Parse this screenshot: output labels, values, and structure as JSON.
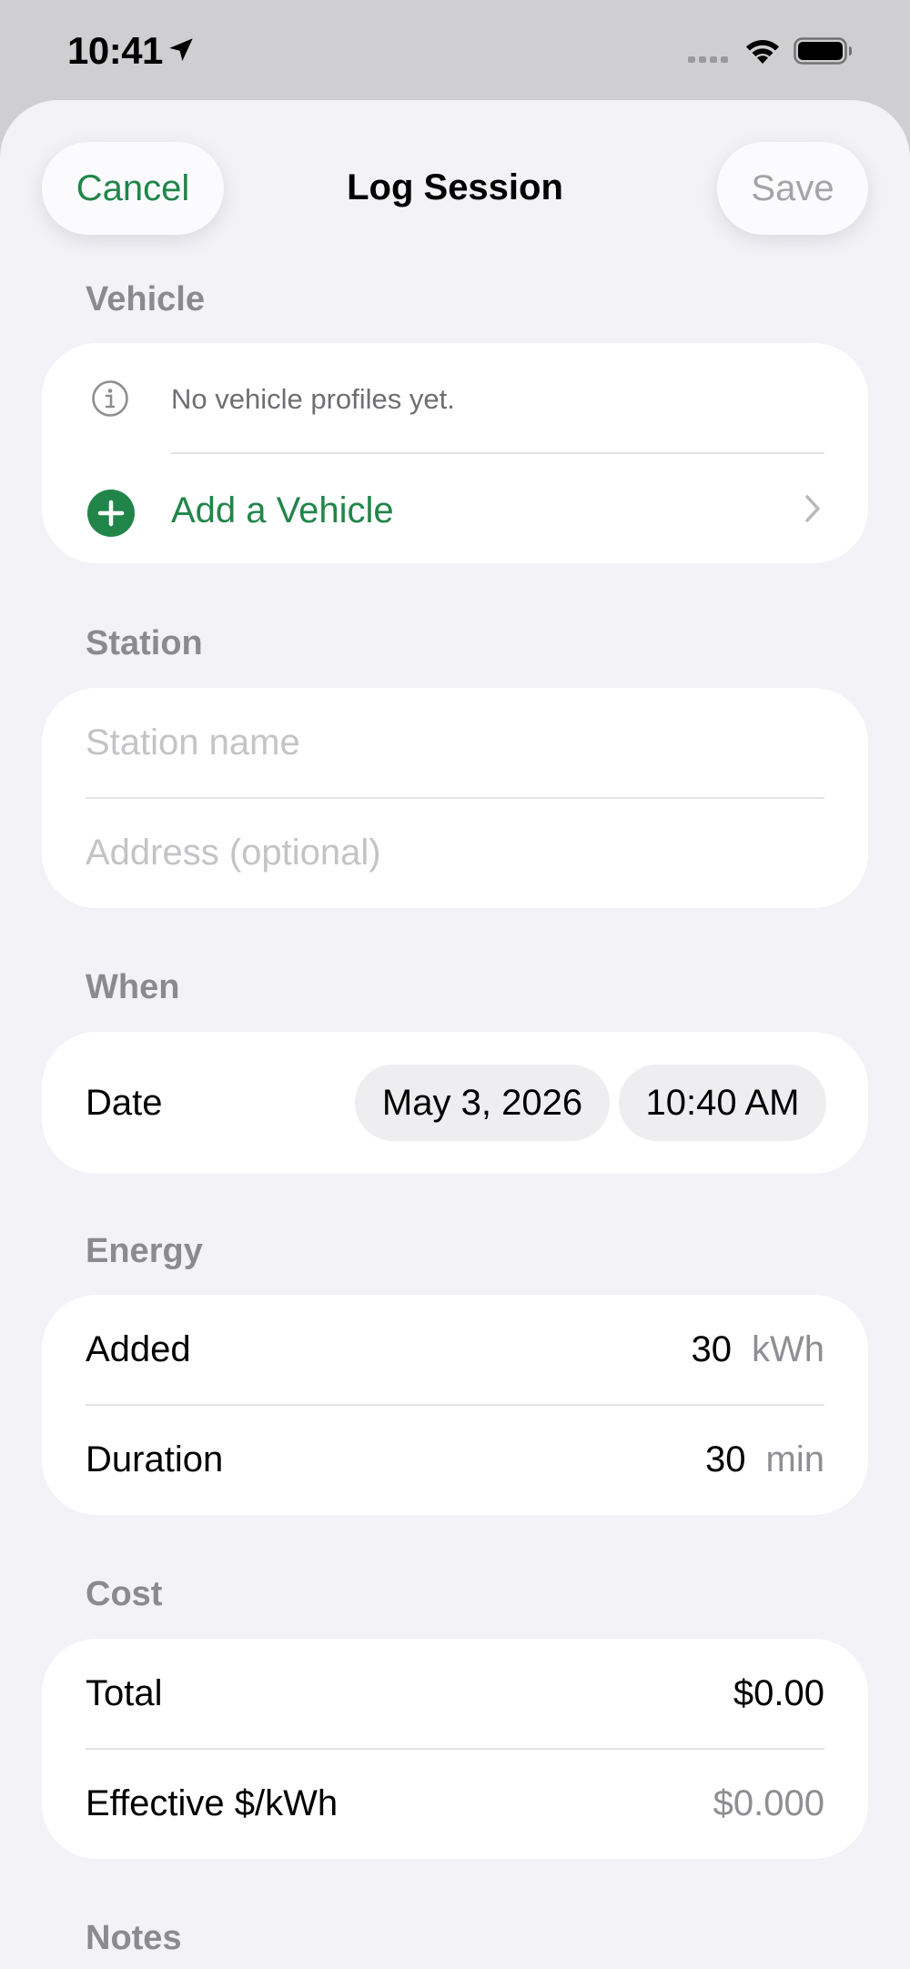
{
  "status_bar": {
    "time": "10:41",
    "icons": [
      "location-arrow-icon",
      "signal-icon",
      "wifi-icon",
      "battery-icon"
    ]
  },
  "nav": {
    "cancel_label": "Cancel",
    "title": "Log Session",
    "save_label": "Save"
  },
  "colors": {
    "accent": "#21854a",
    "background": "#f2f2f7",
    "card": "#ffffff",
    "secondary_text": "#8a8a8f",
    "placeholder": "#c4c4c7"
  },
  "sections": {
    "vehicle": {
      "header": "Vehicle",
      "info_text": "No vehicle profiles yet.",
      "info_icon": "info-icon",
      "add_label": "Add a Vehicle",
      "add_icon": "plus-circle-icon",
      "chevron_icon": "chevron-right-icon"
    },
    "station": {
      "header": "Station",
      "name_placeholder": "Station name",
      "address_placeholder": "Address (optional)"
    },
    "when": {
      "header": "When",
      "date_label": "Date",
      "date_value": "May 3, 2026",
      "time_value": "10:40 AM"
    },
    "energy": {
      "header": "Energy",
      "added_label": "Added",
      "added_value": "30",
      "added_unit": "kWh",
      "duration_label": "Duration",
      "duration_value": "30",
      "duration_unit": "min"
    },
    "cost": {
      "header": "Cost",
      "total_label": "Total",
      "total_value": "$0.00",
      "effective_label": "Effective $/kWh",
      "effective_value": "$0.000"
    },
    "notes": {
      "header": "Notes"
    }
  }
}
